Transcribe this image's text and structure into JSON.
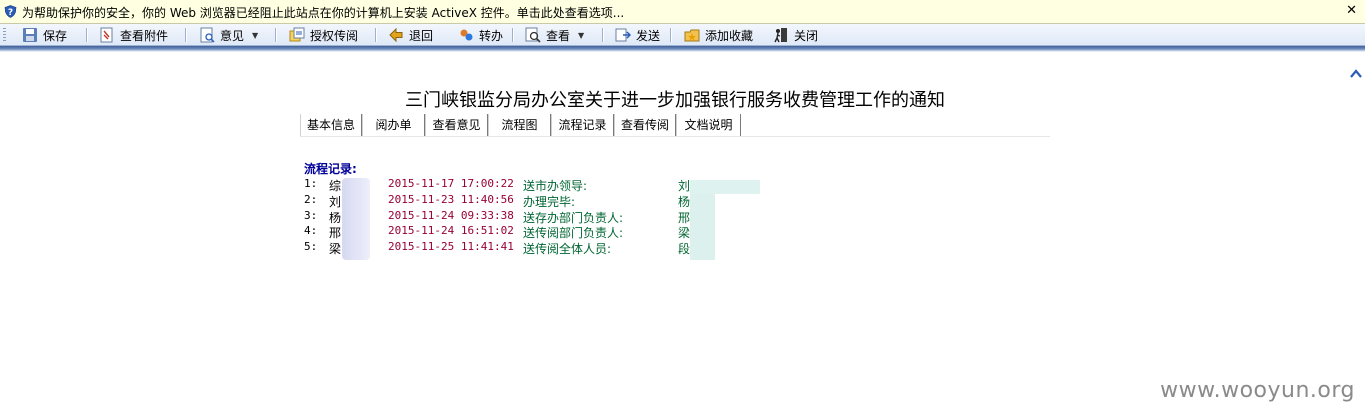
{
  "infobar": {
    "message": "为帮助保护你的安全，你的 Web 浏览器已经阻止此站点在你的计算机上安装 ActiveX 控件。单击此处查看选项...",
    "close": "✕"
  },
  "toolbar": {
    "save": "保存",
    "view_attachment": "查看附件",
    "opinion": "意见",
    "auth_circulate": "授权传阅",
    "return": "退回",
    "forward": "转办",
    "view": "查看",
    "send": "发送",
    "add_favorite": "添加收藏",
    "close": "关闭"
  },
  "document": {
    "title": "三门峡银监分局办公室关于进一步加强银行服务收费管理工作的通知",
    "tabs": [
      "基本信息",
      "阅办单",
      "查看意见",
      "流程图",
      "流程记录",
      "查看传阅",
      "文档说明"
    ],
    "records_title": "流程记录:",
    "records": [
      {
        "no": "1:",
        "user": "综",
        "time": "2015-11-17 17:00:22",
        "action": "送市办领导:",
        "to": "刘"
      },
      {
        "no": "2:",
        "user": "刘",
        "time": "2015-11-23 11:40:56",
        "action": "办理完毕:",
        "to": "杨"
      },
      {
        "no": "3:",
        "user": "杨",
        "time": "2015-11-24 09:33:38",
        "action": "送存办部门负责人:",
        "to": "邢"
      },
      {
        "no": "4:",
        "user": "邢",
        "time": "2015-11-24 16:51:02",
        "action": "送传阅部门负责人:",
        "to": "梁"
      },
      {
        "no": "5:",
        "user": "梁",
        "time": "2015-11-25 11:41:41",
        "action": "送传阅全体人员:",
        "to": "段"
      }
    ]
  },
  "watermark": "www.wooyun.org",
  "colors": {
    "infobar_bg": "#ffffe1",
    "records_title": "#000099",
    "time": "#990033",
    "action": "#006633"
  }
}
